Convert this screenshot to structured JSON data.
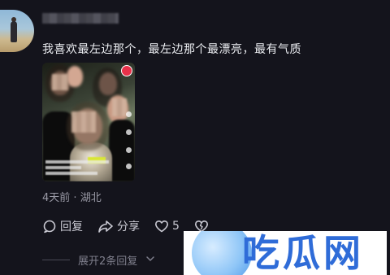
{
  "comment": {
    "text": "我喜欢最左边那个，最左边那个最漂亮，最有气质",
    "time": "4天前",
    "separator": "·",
    "location": "湖北"
  },
  "actions": {
    "reply_icon": "comment-bubble-icon",
    "reply_label": "回复",
    "share_icon": "share-arrow-icon",
    "share_label": "分享",
    "like_icon": "heart-icon",
    "like_count": "5",
    "dislike_icon": "broken-heart-icon"
  },
  "replies": {
    "expand_label": "展开2条回复"
  },
  "watermark": {
    "text": "吃瓜网"
  },
  "colors": {
    "background": "#14141c",
    "text": "#eceef2",
    "muted": "#9a9aa6",
    "watermark_blue": "#2f6cd8"
  }
}
